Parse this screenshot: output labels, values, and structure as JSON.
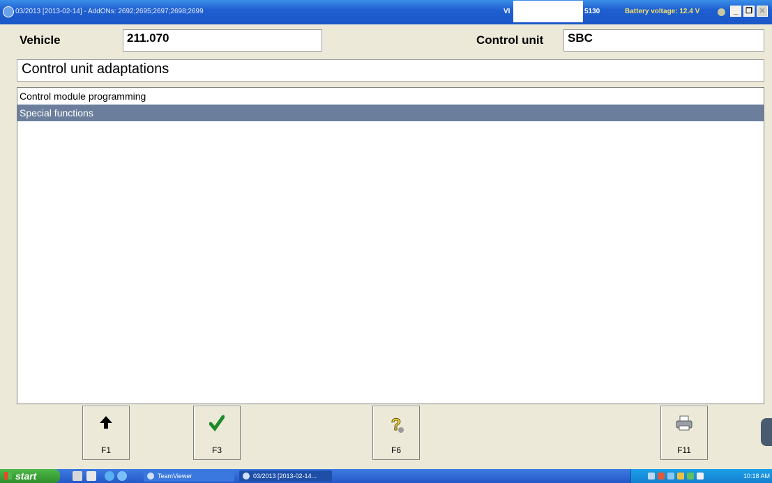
{
  "titlebar": {
    "title": "03/2013 [2013-02-14] - AddONs: 2692;2695;2697;2698;2699",
    "vin_label": "VI",
    "vin_tail": "5130",
    "battery": "Battery voltage: 12.4 V",
    "minimize": "_",
    "restore": "❐",
    "close": "✕"
  },
  "header": {
    "vehicle_label": "Vehicle",
    "vehicle_value": "211.070",
    "control_unit_label": "Control unit",
    "control_unit_value": "SBC"
  },
  "section_title": "Control unit adaptations",
  "menu": {
    "items": [
      "Control module programming",
      "Special functions"
    ],
    "selected_index": 1
  },
  "fkeys": [
    {
      "label": "F1",
      "icon": "up-arrow-icon"
    },
    {
      "label": "F3",
      "icon": "checkmark-icon"
    },
    {
      "label": "F6",
      "icon": "help-question-icon"
    },
    {
      "label": "F11",
      "icon": "printer-icon"
    }
  ],
  "taskbar": {
    "start_label": "start",
    "tasks": [
      "TeamViewer",
      "03/2013 [2013-02-14..."
    ],
    "clock": "10:18 AM"
  },
  "colors": {
    "titlebar": "#1f5fd1",
    "selection": "#6b7f9c",
    "window_bg": "#ece9d8"
  }
}
